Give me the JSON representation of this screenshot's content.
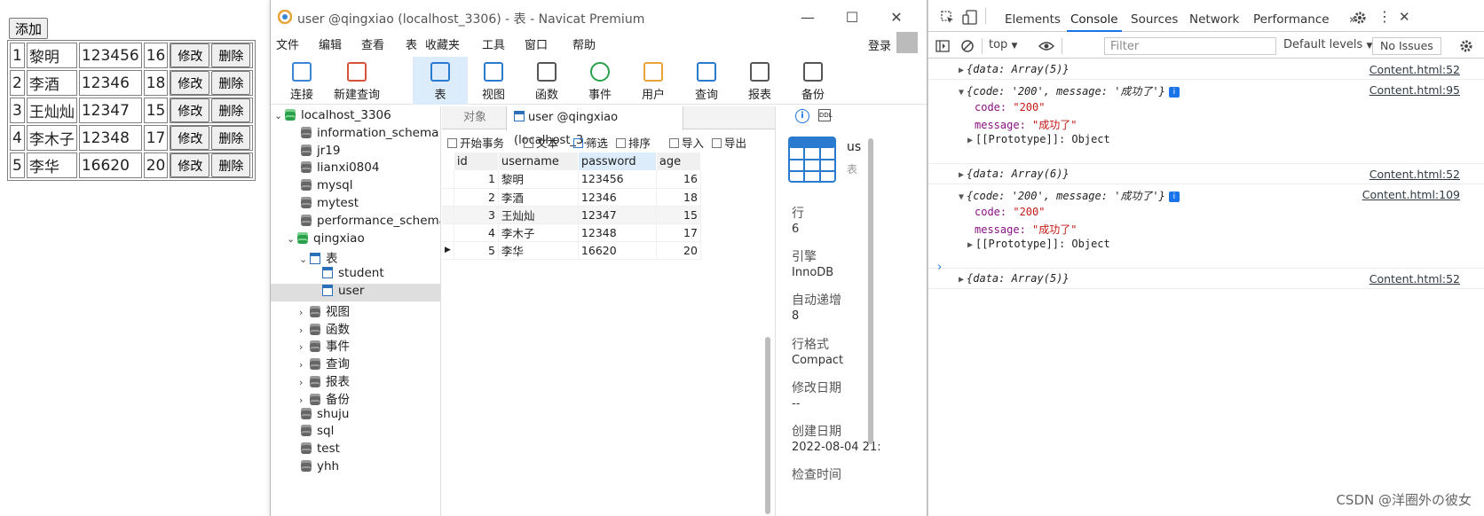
{
  "webpage": {
    "add_label": "添加",
    "rows": [
      {
        "idx": "1",
        "name": "黎明",
        "pwd": "123456",
        "age": "16",
        "edit": "修改",
        "del": "删除"
      },
      {
        "idx": "2",
        "name": "李酒",
        "pwd": "12346",
        "age": "18",
        "edit": "修改",
        "del": "删除"
      },
      {
        "idx": "3",
        "name": "王灿灿",
        "pwd": "12347",
        "age": "15",
        "edit": "修改",
        "del": "删除"
      },
      {
        "idx": "4",
        "name": "李木子",
        "pwd": "12348",
        "age": "17",
        "edit": "修改",
        "del": "删除"
      },
      {
        "idx": "5",
        "name": "李华",
        "pwd": "16620",
        "age": "20",
        "edit": "修改",
        "del": "删除"
      }
    ]
  },
  "navicat": {
    "title": "user @qingxiao (localhost_3306) - 表 - Navicat Premium",
    "menu": [
      "文件",
      "编辑",
      "查看",
      "表",
      "收藏夹",
      "工具",
      "窗口",
      "帮助"
    ],
    "login": "登录",
    "toolbar": [
      "连接",
      "新建查询",
      "表",
      "视图",
      "函数",
      "事件",
      "用户",
      "查询",
      "报表",
      "备份"
    ],
    "tree": {
      "connection": "localhost_3306",
      "databases_top": [
        "information_schema",
        "jr19",
        "lianxi0804",
        "mysql",
        "mytest",
        "performance_schema"
      ],
      "open_db": "qingxiao",
      "tables_node": "表",
      "tables": [
        "student",
        "user"
      ],
      "groups": [
        "视图",
        "函数",
        "事件",
        "查询",
        "报表",
        "备份"
      ],
      "databases_bottom": [
        "shuju",
        "sql",
        "test",
        "yhh"
      ]
    },
    "tabs": {
      "objects": "对象",
      "current": "user @qingxiao (localhost_3..."
    },
    "subtoolbar": [
      "开始事务",
      "文本",
      "筛选",
      "排序",
      "导入",
      "导出"
    ],
    "grid": {
      "columns": [
        "id",
        "username",
        "password",
        "age"
      ],
      "rows": [
        [
          "1",
          "黎明",
          "123456",
          "16"
        ],
        [
          "2",
          "李酒",
          "12346",
          "18"
        ],
        [
          "3",
          "王灿灿",
          "12347",
          "15"
        ],
        [
          "4",
          "李木子",
          "12348",
          "17"
        ],
        [
          "5",
          "李华",
          "16620",
          "20"
        ]
      ]
    },
    "info": {
      "name_short": "us",
      "type": "表",
      "rows_label": "行",
      "rows_val": "6",
      "engine_label": "引擎",
      "engine_val": "InnoDB",
      "autoinc_label": "自动递增",
      "autoinc_val": "8",
      "rowformat_label": "行格式",
      "rowformat_val": "Compact",
      "modified_label": "修改日期",
      "modified_val": "--",
      "created_label": "创建日期",
      "created_val": "2022-08-04 21:",
      "checked_label": "检查时间"
    }
  },
  "devtools": {
    "tabs": [
      "Elements",
      "Console",
      "Sources",
      "Network",
      "Performance",
      "»"
    ],
    "active_tab": "Console",
    "context": "top",
    "filter_placeholder": "Filter",
    "levels": "Default levels",
    "issues": "No Issues",
    "logs": [
      {
        "text": "{data: Array(5)}",
        "src": "Content.html:52"
      },
      {
        "text": "{code: '200', message: '成功了'}",
        "src": "Content.html:95",
        "code": "\"200\"",
        "message": "\"成功了\"",
        "proto": "[[Prototype]]: Object"
      },
      {
        "text": "{data: Array(6)}",
        "src": "Content.html:52"
      },
      {
        "text": "{code: '200', message: '成功了'}",
        "src": "Content.html:109",
        "code": "\"200\"",
        "message": "\"成功了\"",
        "proto": "[[Prototype]]: Object"
      },
      {
        "text": "{data: Array(5)}",
        "src": "Content.html:52"
      }
    ]
  },
  "watermark": "CSDN @洋圈外の彼女"
}
